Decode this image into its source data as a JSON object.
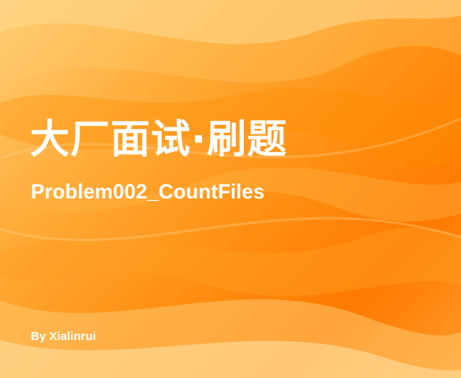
{
  "cover": {
    "title": "大厂面试·刷题",
    "subtitle": "Problem002_CountFiles",
    "author": "By Xialinrui"
  },
  "colors": {
    "background_light": "#ffd07a",
    "background_mid": "#ff9114",
    "background_deep": "#ff7a00",
    "text": "#ffffff"
  }
}
